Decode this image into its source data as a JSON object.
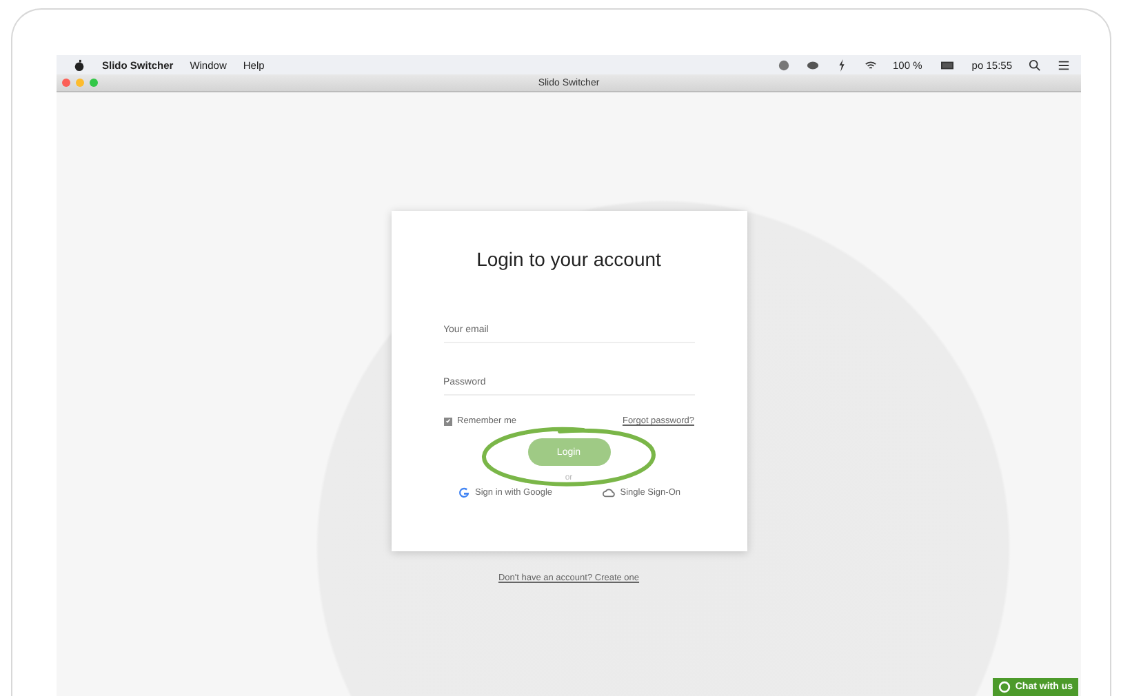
{
  "menu_bar": {
    "app_name": "Slido Switcher",
    "menus": [
      "Window",
      "Help"
    ],
    "status": {
      "battery": "100 %",
      "clock": "po 15:55"
    }
  },
  "window": {
    "title": "Slido Switcher"
  },
  "login": {
    "title": "Login to your account",
    "fields": [
      {
        "placeholder": "Your email"
      },
      {
        "placeholder": "Password"
      }
    ],
    "remember": {
      "label": "Remember me",
      "checked": true
    },
    "forgot_link": "Forgot password?",
    "login_button": {
      "label": "Login",
      "disabled": true,
      "highlighted": true
    },
    "separator": "or",
    "providers": [
      {
        "label": "Sign in with Google",
        "kind": "google"
      },
      {
        "label": "Single Sign-On",
        "kind": "sso"
      }
    ]
  },
  "signup_link": "Don't have an account? Create one",
  "chat_button": "Chat with us"
}
